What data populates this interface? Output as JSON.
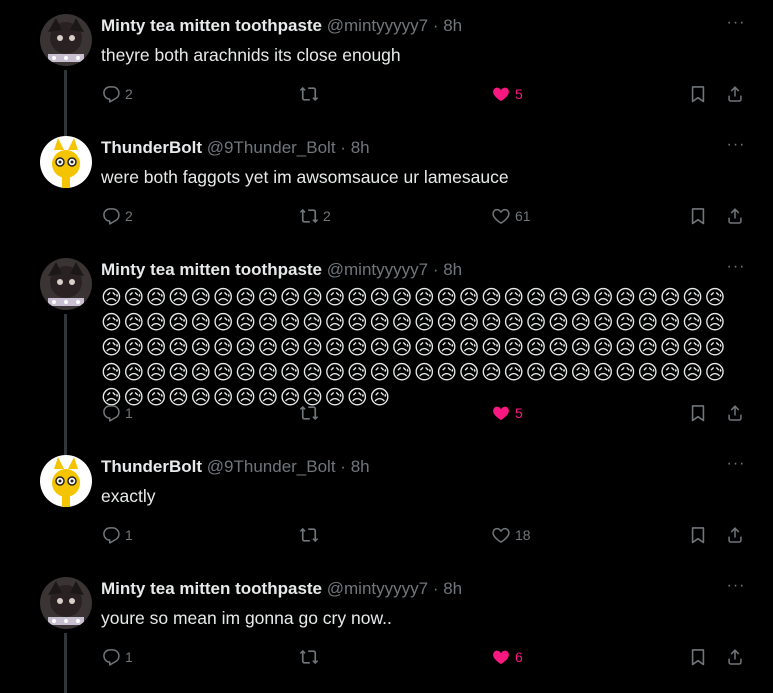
{
  "tweets": [
    {
      "name": "Minty tea mitten toothpaste",
      "handle": "@mintyyyyy7",
      "dot": "·",
      "time": "8h",
      "text": "theyre both arachnids its close enough",
      "replies": "2",
      "retweets": "",
      "likes": "5",
      "liked": true
    },
    {
      "name": "ThunderBolt",
      "handle": "@9Thunder_Bolt",
      "dot": "·",
      "time": "8h",
      "text": "were both faggots yet im awsomsauce ur lamesauce",
      "replies": "2",
      "retweets": "2",
      "likes": "61",
      "liked": false
    },
    {
      "name": "Minty tea mitten toothpaste",
      "handle": "@mintyyyyy7",
      "dot": "·",
      "time": "8h",
      "text": "😥😥😥😥😥😥😥😥😥😥😥😥😥😥😥😥😥😥😥😥😥😥😥😥😥😥😥😥😥😥😥😥😥😥😥😥😥😥😥😥😥😥😥😥😥😥😥😥😥😥😥😥😥😥😥😥😥😥😥😥😥😥😥😥😥😥😥😥😥😥😥😥😥😥😥😥😥😥😥😥😥😥😥😥😥😥😥😥😥😥😥😥😥😥😥😥😥😥😥😥😥😥😥😥😥😥😥😥😥😥😥😥😥😥😥😥😥😥😥😥😥😥😥😥😥",
      "replies": "1",
      "retweets": "",
      "likes": "5",
      "liked": true
    },
    {
      "name": "ThunderBolt",
      "handle": "@9Thunder_Bolt",
      "dot": "·",
      "time": "8h",
      "text": "exactly",
      "replies": "1",
      "retweets": "",
      "likes": "18",
      "liked": false
    },
    {
      "name": "Minty tea mitten toothpaste",
      "handle": "@mintyyyyy7",
      "dot": "·",
      "time": "8h",
      "text": "youre so mean im gonna go cry now..",
      "replies": "1",
      "retweets": "",
      "likes": "6",
      "liked": true
    }
  ],
  "icons": {
    "reply": "reply-icon",
    "retweet": "retweet-icon",
    "like": "heart-icon",
    "bookmark": "bookmark-icon",
    "share": "share-icon",
    "more": "more-icon"
  },
  "colors": {
    "background": "#000000",
    "text": "#e7e9ea",
    "secondary": "#71767b",
    "like": "#f91880",
    "thread_line": "#333639"
  }
}
